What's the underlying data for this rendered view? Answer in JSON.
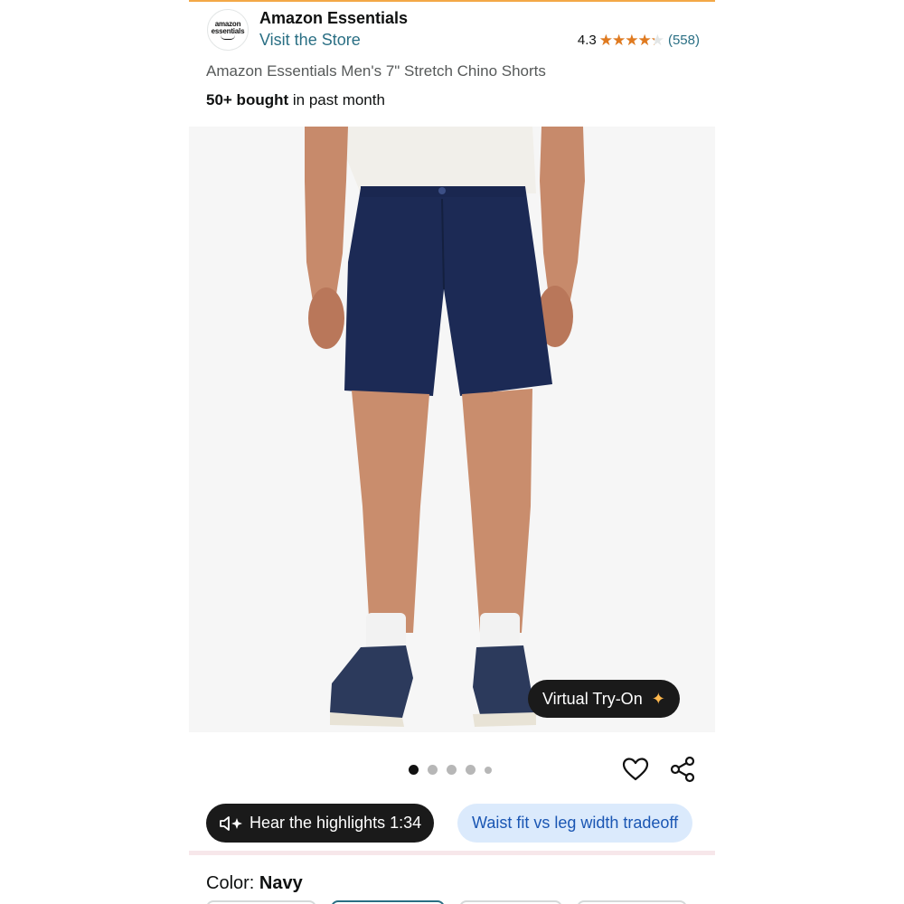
{
  "brand": {
    "logo_line1": "amazon",
    "logo_line2": "essentials",
    "name": "Amazon Essentials",
    "store_link": "Visit the Store"
  },
  "rating": {
    "value": "4.3",
    "stars_fraction": 0.86,
    "stars_glyphs": "★★★★★",
    "count": "(558)"
  },
  "product": {
    "title": "Amazon Essentials Men's 7\" Stretch Chino Shorts",
    "bought_bold": "50+ bought",
    "bought_rest": " in past month"
  },
  "hero": {
    "image_icon": "product-photo-navy-shorts",
    "try_on_label": "Virtual Try-On",
    "try_on_icon": "sparkle-icon"
  },
  "carousel": {
    "count": 5,
    "active_index": 0
  },
  "actions": {
    "favorite_icon": "heart-icon",
    "share_icon": "share-icon"
  },
  "chips": {
    "highlights_label": "Hear the highlights 1:34",
    "highlights_icon": "speaker-sparkle-icon",
    "question_label": "Waist fit vs leg width tradeoff"
  },
  "color": {
    "label": "Color: ",
    "value": "Navy"
  },
  "colors": {
    "accent_orange": "#e07a1f",
    "link_teal": "#2a6f84",
    "chip_blue_bg": "#dbeafc",
    "chip_blue_text": "#1a56b3",
    "dark_chip": "#1a1a1a"
  }
}
